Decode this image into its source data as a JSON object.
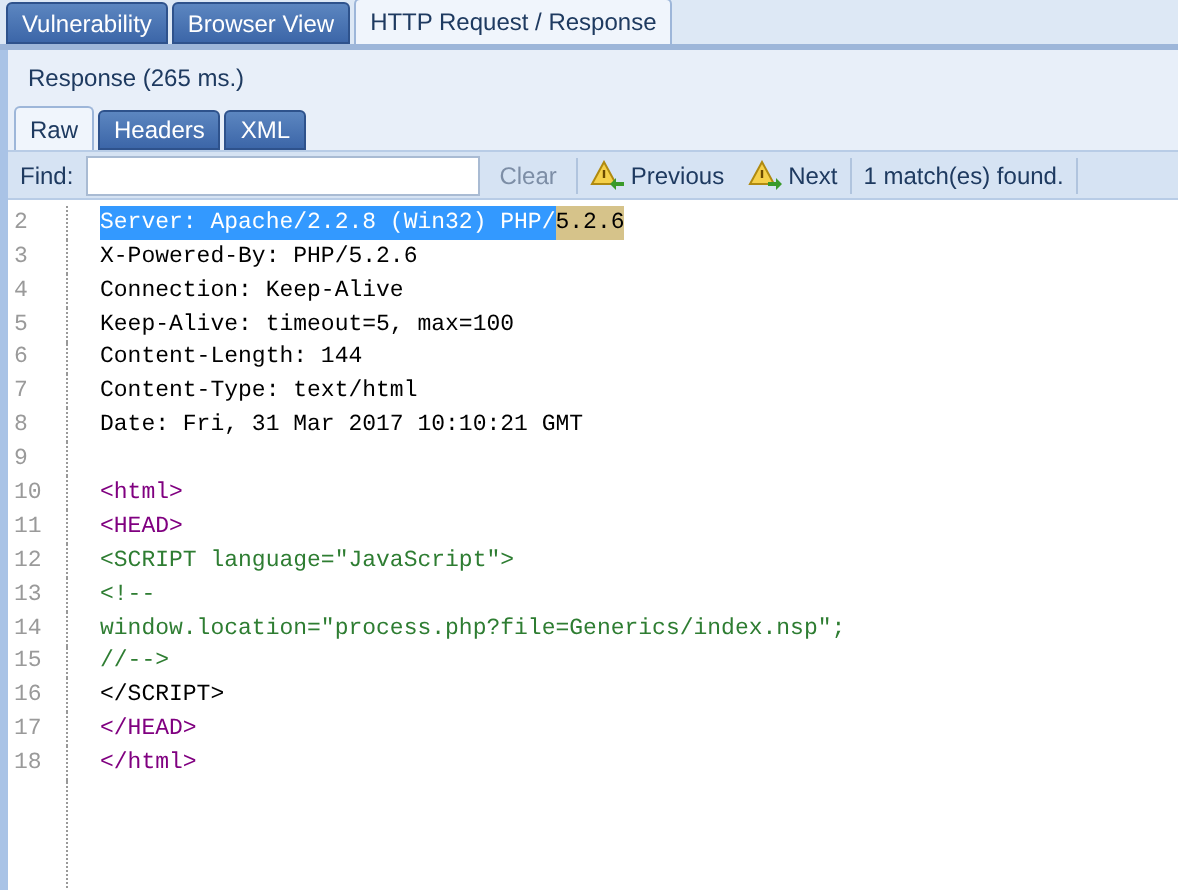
{
  "top_tabs": [
    {
      "label": "Vulnerability",
      "selected": false
    },
    {
      "label": "Browser View",
      "selected": false
    },
    {
      "label": "HTTP Request / Response",
      "selected": true
    }
  ],
  "panel_title": "Response (265 ms.)",
  "view_tabs": [
    {
      "label": "Raw",
      "selected": true
    },
    {
      "label": "Headers",
      "selected": false
    },
    {
      "label": "XML",
      "selected": false
    }
  ],
  "find_bar": {
    "label": "Find:",
    "clear": "Clear",
    "clear_disabled": true,
    "previous": "Previous",
    "next": "Next",
    "status": "1 match(es) found."
  },
  "lines": [
    {
      "number": "2",
      "segments": [
        {
          "kind": "selected",
          "text": "Server: Apache/2.2.8 (Win32) PHP/"
        },
        {
          "kind": "match",
          "text": "5.2.6"
        }
      ]
    },
    {
      "number": "3",
      "segments": [
        {
          "kind": "plain",
          "text": "X-Powered-By: PHP/5.2.6"
        }
      ]
    },
    {
      "number": "4",
      "segments": [
        {
          "kind": "plain",
          "text": "Connection: Keep-Alive"
        }
      ]
    },
    {
      "number": "5",
      "segments": [
        {
          "kind": "plain",
          "text": "Keep-Alive: timeout=5, max=100"
        }
      ]
    },
    {
      "number": "6",
      "segments": [
        {
          "kind": "plain",
          "text": "Content-Length: 144"
        }
      ]
    },
    {
      "number": "7",
      "segments": [
        {
          "kind": "plain",
          "text": "Content-Type: text/html"
        }
      ]
    },
    {
      "number": "8",
      "segments": [
        {
          "kind": "plain",
          "text": "Date: Fri, 31 Mar 2017 10:10:21 GMT"
        }
      ]
    },
    {
      "number": "9"
    },
    {
      "number": "10",
      "segments": [
        {
          "kind": "tag",
          "text": "<html>"
        }
      ]
    },
    {
      "number": "11",
      "segments": [
        {
          "kind": "tag",
          "text": "<HEAD>"
        }
      ]
    },
    {
      "number": "12",
      "segments": [
        {
          "kind": "script",
          "text": "<SCRIPT language=\"JavaScript\">"
        }
      ]
    },
    {
      "number": "13",
      "segments": [
        {
          "kind": "script",
          "text": "<!--"
        }
      ]
    },
    {
      "number": "14",
      "segments": [
        {
          "kind": "script",
          "text": "window.location=\"process.php?file=Generics/index.nsp\";"
        }
      ]
    },
    {
      "number": "15",
      "segments": [
        {
          "kind": "script",
          "text": "//-->"
        }
      ]
    },
    {
      "number": "16",
      "segments": [
        {
          "kind": "plain",
          "text": "</SCRIPT>"
        }
      ]
    },
    {
      "number": "17",
      "segments": [
        {
          "kind": "tag",
          "text": "</HEAD>"
        }
      ]
    },
    {
      "number": "18",
      "segments": [
        {
          "kind": "tag",
          "text": "</html>"
        }
      ]
    }
  ]
}
